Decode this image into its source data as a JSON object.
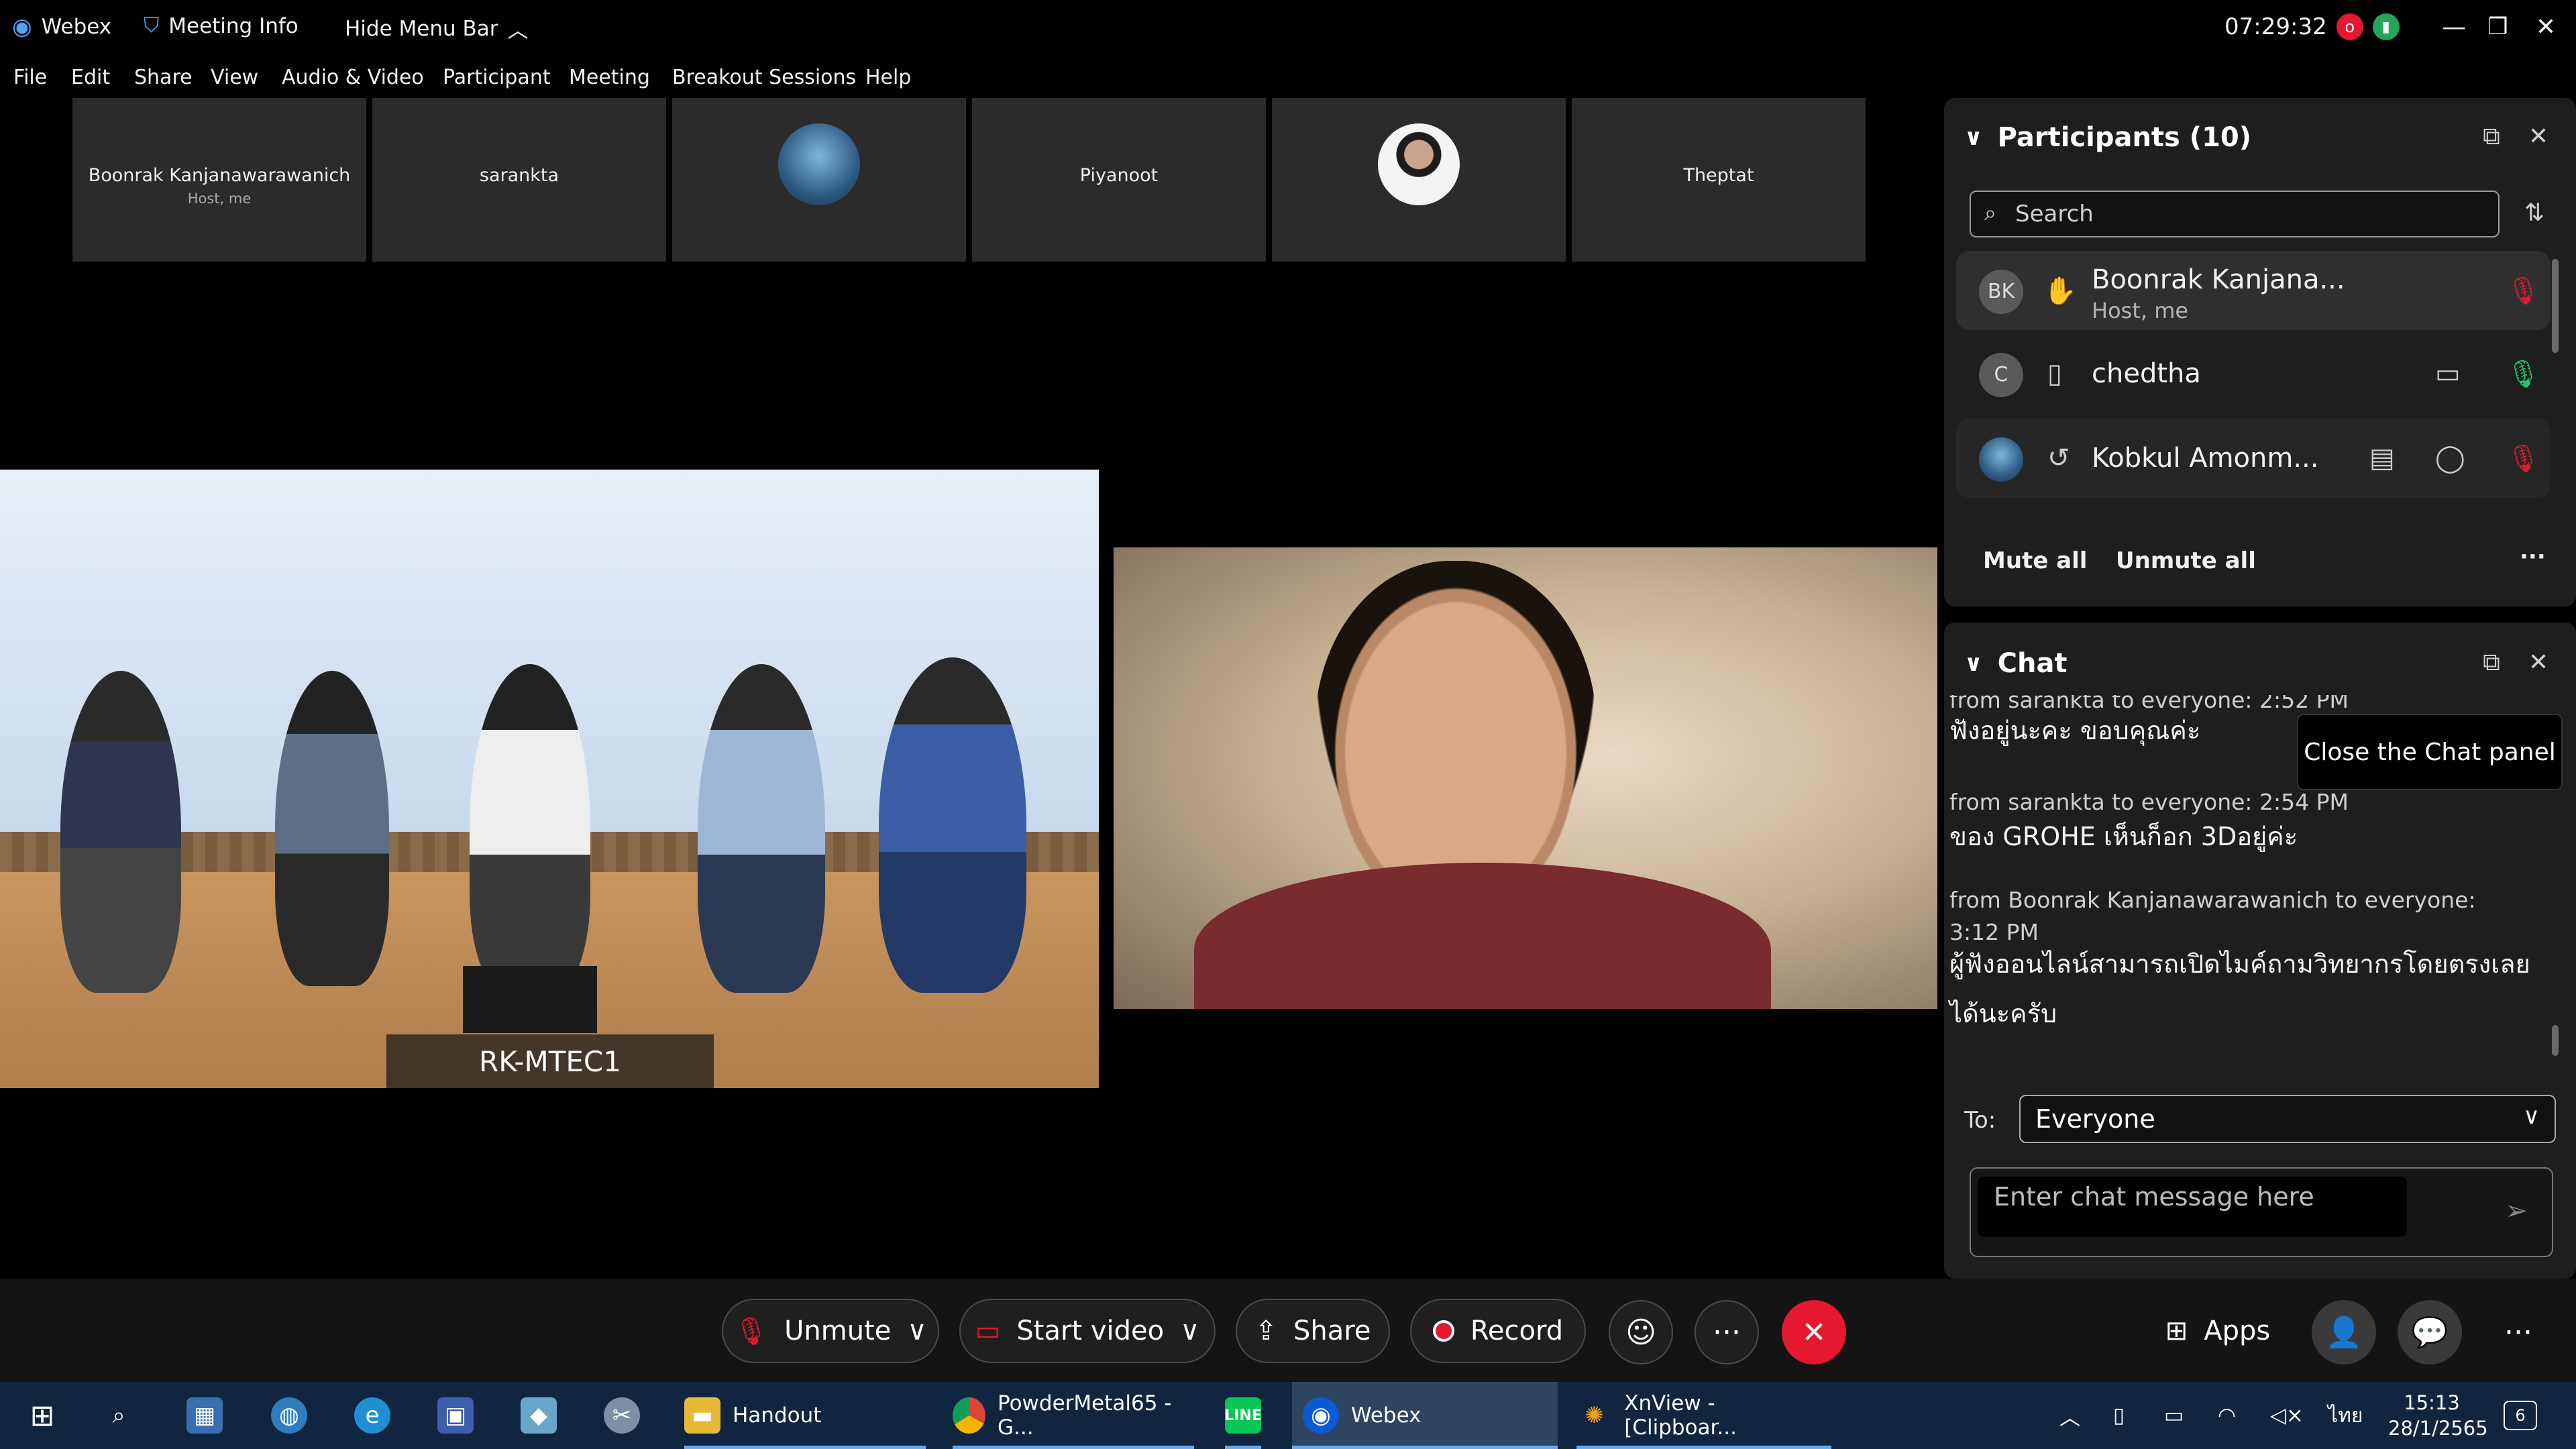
{
  "titlebar": {
    "app": "Webex",
    "meeting_info": "Meeting Info",
    "hide_menu": "Hide Menu Bar",
    "clock": "07:29:32",
    "rec_badge": "o"
  },
  "menu": [
    "File",
    "Edit",
    "Share",
    "View",
    "Audio & Video",
    "Participant",
    "Meeting",
    "Breakout Sessions",
    "Help"
  ],
  "filmstrip": [
    {
      "name": "Boonrak Kanjanawarawanich",
      "sub": "Host, me"
    },
    {
      "name": "sarankta",
      "sub": ""
    },
    {
      "name": "",
      "sub": ""
    },
    {
      "name": "Piyanoot",
      "sub": ""
    },
    {
      "name": "",
      "sub": ""
    },
    {
      "name": "Theptat",
      "sub": ""
    }
  ],
  "videos": {
    "room_label": "RK-MTEC1"
  },
  "participants": {
    "title": "Participants (10)",
    "search_placeholder": "Search",
    "rows": [
      {
        "initials": "BK",
        "name": "Boonrak Kanjana...",
        "sub": "Host, me"
      },
      {
        "initials": "C",
        "name": "chedtha",
        "sub": ""
      },
      {
        "initials": "",
        "name": "Kobkul Amonm...",
        "sub": ""
      }
    ],
    "mute_all": "Mute all",
    "unmute_all": "Unmute all",
    "more": "···"
  },
  "chat": {
    "title": "Chat",
    "clipped_header": "from sarankta to everyone:    2:52 PM",
    "messages": [
      {
        "header": "",
        "text": "ฟังอยู่นะคะ ขอบคุณค่ะ"
      },
      {
        "header": "from sarankta to everyone:    2:54 PM",
        "text": "ของ GROHE เห็นก็อก 3Dอยู่ค่ะ"
      },
      {
        "header": "from Boonrak Kanjanawarawanich to everyone:    3:12 PM",
        "text": "ผู้ฟังออนไลน์สามารถเปิดไมค์ถามวิทยากรโดยตรงเลยได้นะครับ"
      }
    ],
    "tooltip": "Close the Chat panel",
    "to_label": "To:",
    "to_value": "Everyone",
    "input_placeholder": "Enter chat message here"
  },
  "controls": {
    "unmute": "Unmute",
    "start_video": "Start video",
    "share": "Share",
    "record": "Record",
    "apps": "Apps",
    "more": "···"
  },
  "taskbar": {
    "items": [
      {
        "label": "Handout"
      },
      {
        "label": "PowderMetal65 - G..."
      },
      {
        "label": "Webex"
      },
      {
        "label": "XnView - [Clipboar..."
      }
    ],
    "lang": "ไทย",
    "time": "15:13",
    "date": "28/1/2565",
    "notif": "6"
  },
  "colors": {
    "accent": "#e5182f",
    "taskbar": "#10253f",
    "panel": "#1e1e1e",
    "green": "#25c26e"
  }
}
